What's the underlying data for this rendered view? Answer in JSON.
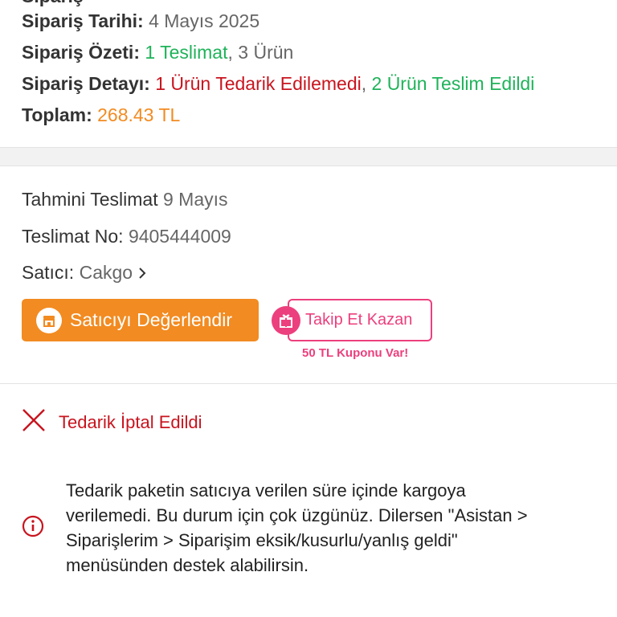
{
  "summary": {
    "date_label": "Sipariş Tarihi:",
    "date_value": "4 Mayıs 2025",
    "overview_label": "Sipariş Özeti:",
    "overview_deliveries": "1 Teslimat",
    "overview_sep": ",",
    "overview_items": " 3 Ürün",
    "detail_label": "Sipariş Detayı:",
    "detail_failed": "1 Ürün Tedarik Edilemedi",
    "detail_sep": ",",
    "detail_delivered": " 2 Ürün Teslim Edildi",
    "total_label": "Toplam:",
    "total_value": "268.43 TL"
  },
  "delivery": {
    "estimate_label": "Tahmini Teslimat",
    "estimate_value": "9 Mayıs",
    "number_label": "Teslimat No:",
    "number_value": "9405444009",
    "seller_label": "Satıcı:",
    "seller_value": "Cakgo",
    "rate_button": "Satıcıyı Değerlendir",
    "follow_button": "Takip Et Kazan",
    "coupon_text": "50 TL Kuponu Var!"
  },
  "status": {
    "title": "Tedarik İptal Edildi",
    "message": "Tedarik paketin satıcıya verilen süre içinde kargoya\nverilemedi. Bu durum için çok üzgünüz. Dilersen \"Asistan >\nSiparişlerim > Siparişim eksik/kusurlu/yanlış geldi\"\nmenüsünden destek alabilirsin."
  },
  "colors": {
    "green": "#1fb35a",
    "red": "#c8141e",
    "orange": "#f28b21",
    "pink": "#ec3f7d"
  },
  "icons": [
    "store-icon",
    "gift-icon",
    "close-x-icon",
    "info-icon",
    "chevron-right-icon"
  ]
}
